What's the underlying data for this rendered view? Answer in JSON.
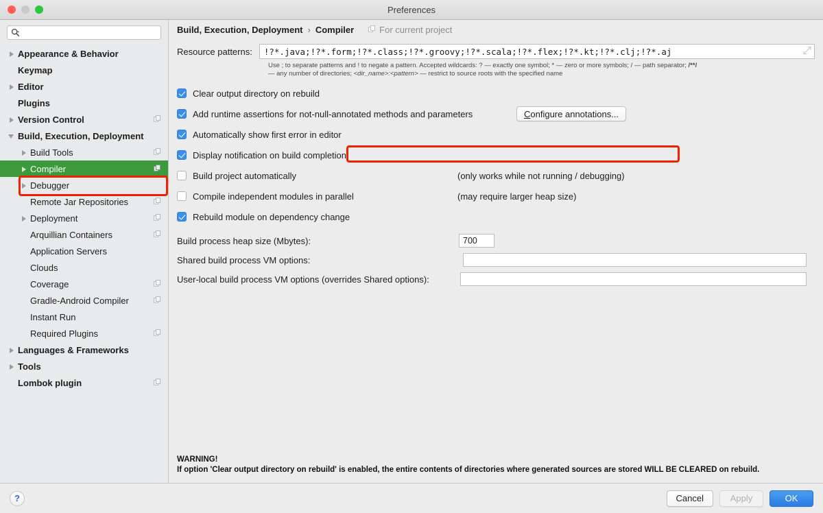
{
  "window": {
    "title": "Preferences"
  },
  "search": {
    "value": "",
    "placeholder": ""
  },
  "sidebar": {
    "items": [
      {
        "label": "Appearance & Behavior",
        "level": 0,
        "bold": true,
        "arrow": "closed",
        "copy": false,
        "selected": false
      },
      {
        "label": "Keymap",
        "level": 0,
        "bold": true,
        "arrow": "none",
        "copy": false,
        "selected": false
      },
      {
        "label": "Editor",
        "level": 0,
        "bold": true,
        "arrow": "closed",
        "copy": false,
        "selected": false
      },
      {
        "label": "Plugins",
        "level": 0,
        "bold": true,
        "arrow": "none",
        "copy": false,
        "selected": false
      },
      {
        "label": "Version Control",
        "level": 0,
        "bold": true,
        "arrow": "closed",
        "copy": true,
        "selected": false
      },
      {
        "label": "Build, Execution, Deployment",
        "level": 0,
        "bold": true,
        "arrow": "open",
        "copy": false,
        "selected": false
      },
      {
        "label": "Build Tools",
        "level": 1,
        "bold": false,
        "arrow": "closed",
        "copy": true,
        "selected": false
      },
      {
        "label": "Compiler",
        "level": 1,
        "bold": false,
        "arrow": "closed",
        "copy": true,
        "selected": true
      },
      {
        "label": "Debugger",
        "level": 1,
        "bold": false,
        "arrow": "closed",
        "copy": false,
        "selected": false
      },
      {
        "label": "Remote Jar Repositories",
        "level": 2,
        "bold": false,
        "arrow": "none",
        "copy": true,
        "selected": false
      },
      {
        "label": "Deployment",
        "level": 1,
        "bold": false,
        "arrow": "closed",
        "copy": true,
        "selected": false
      },
      {
        "label": "Arquillian Containers",
        "level": 2,
        "bold": false,
        "arrow": "none",
        "copy": true,
        "selected": false
      },
      {
        "label": "Application Servers",
        "level": 2,
        "bold": false,
        "arrow": "none",
        "copy": false,
        "selected": false
      },
      {
        "label": "Clouds",
        "level": 2,
        "bold": false,
        "arrow": "none",
        "copy": false,
        "selected": false
      },
      {
        "label": "Coverage",
        "level": 2,
        "bold": false,
        "arrow": "none",
        "copy": true,
        "selected": false
      },
      {
        "label": "Gradle-Android Compiler",
        "level": 2,
        "bold": false,
        "arrow": "none",
        "copy": true,
        "selected": false
      },
      {
        "label": "Instant Run",
        "level": 2,
        "bold": false,
        "arrow": "none",
        "copy": false,
        "selected": false
      },
      {
        "label": "Required Plugins",
        "level": 2,
        "bold": false,
        "arrow": "none",
        "copy": true,
        "selected": false
      },
      {
        "label": "Languages & Frameworks",
        "level": 0,
        "bold": true,
        "arrow": "closed",
        "copy": false,
        "selected": false
      },
      {
        "label": "Tools",
        "level": 0,
        "bold": true,
        "arrow": "closed",
        "copy": false,
        "selected": false
      },
      {
        "label": "Lombok plugin",
        "level": 0,
        "bold": true,
        "arrow": "none",
        "copy": true,
        "selected": false
      }
    ]
  },
  "breadcrumb": {
    "parent": "Build, Execution, Deployment",
    "separator": "›",
    "current": "Compiler",
    "scope": "For current project"
  },
  "main": {
    "patterns_label": "Resource patterns:",
    "patterns_value": "!?*.java;!?*.form;!?*.class;!?*.groovy;!?*.scala;!?*.flex;!?*.kt;!?*.clj;!?*.aj",
    "hint_line1_a": "Use ; to separate patterns and ! to negate a pattern. Accepted wildcards: ? — exactly one symbol; * — zero or more symbols; / — path separator; ",
    "hint_line1_b": "/**/",
    "hint_line2_a": "— any number of directories; ",
    "hint_line2_b": "<dir_name>:<pattern>",
    "hint_line2_c": " — restrict to source roots with the specified name",
    "checkboxes": [
      {
        "label": "Clear output directory on rebuild",
        "checked": true,
        "note": ""
      },
      {
        "label": "Add runtime assertions for not-null-annotated methods and parameters",
        "checked": true,
        "note": ""
      },
      {
        "label": "Automatically show first error in editor",
        "checked": true,
        "note": ""
      },
      {
        "label": "Display notification on build completion",
        "checked": true,
        "note": ""
      },
      {
        "label": "Build project automatically",
        "checked": false,
        "note": "(only works while not running / debugging)"
      },
      {
        "label": "Compile independent modules in parallel",
        "checked": false,
        "note": "(may require larger heap size)"
      },
      {
        "label": "Rebuild module on dependency change",
        "checked": true,
        "note": ""
      }
    ],
    "configure_annotations_mnemonic": "C",
    "configure_annotations_rest": "onfigure annotations...",
    "heap_label": "Build process heap size (Mbytes):",
    "heap_value": "700",
    "shared_vm_label": "Shared build process VM options:",
    "shared_vm_value": "",
    "user_vm_label": "User-local build process VM options (overrides Shared options):",
    "user_vm_value": "",
    "warning_title": "WARNING!",
    "warning_body": "If option 'Clear output directory on rebuild' is enabled, the entire contents of directories where generated sources are stored WILL BE CLEARED on rebuild."
  },
  "footer": {
    "help": "?",
    "cancel": "Cancel",
    "apply": "Apply",
    "ok": "OK"
  },
  "colors": {
    "selection_green": "#3c9a3c",
    "annotation_red": "#ee2200",
    "primary_blue": "#2b7de4",
    "checkbox_blue": "#3b8fe8"
  }
}
